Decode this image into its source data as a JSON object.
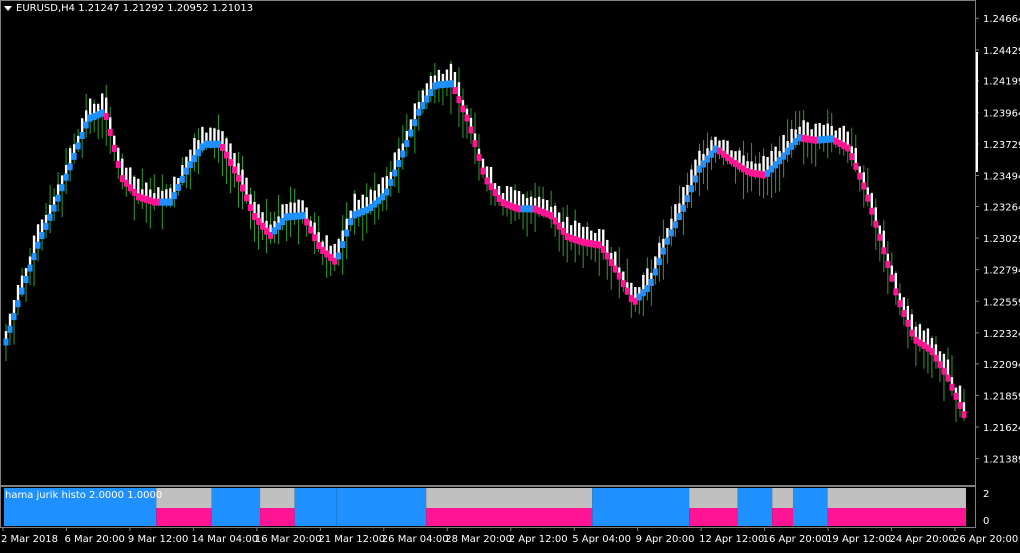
{
  "window": {
    "symbol_header": "EURUSD,H4  1.21247 1.21292 1.20952 1.21013"
  },
  "colors": {
    "background": "#000000",
    "bull": "#1e90ff",
    "bear": "#ff1493",
    "candle": "#ffffff",
    "wick": "#2e9e2e",
    "neutral": "#c0c0c0"
  },
  "subwindow": {
    "label": "hama jurik histo 2.0000 1.0000",
    "ticks": [
      "2",
      "0"
    ]
  },
  "chart_data": {
    "type": "line",
    "title": "EURUSD,H4  1.21247 1.21292 1.20952 1.21013",
    "price_axis": {
      "ylim": [
        1.2123,
        1.2474
      ],
      "ticks": [
        "1.24664",
        "1.24429",
        "1.24199",
        "1.23964",
        "1.23729",
        "1.23494",
        "1.23264",
        "1.23029",
        "1.22794",
        "1.22559",
        "1.22324",
        "1.22094",
        "1.21859",
        "1.21624",
        "1.21389"
      ]
    },
    "time_axis": {
      "labels": [
        "2 Mar 2018",
        "6 Mar 20:00",
        "9 Mar 12:00",
        "14 Mar 04:00",
        "16 Mar 20:00",
        "21 Mar 12:00",
        "26 Mar 04:00",
        "28 Mar 20:00",
        "2 Apr 12:00",
        "5 Apr 04:00",
        "9 Apr 20:00",
        "12 Apr 12:00",
        "16 Apr 20:00",
        "19 Apr 12:00",
        "24 Apr 20:00",
        "26 Apr 20:00"
      ]
    },
    "series": [
      {
        "values": [
          1.2226,
          1.2265,
          1.23,
          1.2328,
          1.236,
          1.2392,
          1.2397,
          1.2348,
          1.2334,
          1.233,
          1.233,
          1.2355,
          1.2373,
          1.2373,
          1.235,
          1.232,
          1.2305,
          1.2319,
          1.232,
          1.2296,
          1.2285,
          1.232,
          1.2325,
          1.2336,
          1.2365,
          1.2397,
          1.2417,
          1.2418,
          1.239,
          1.2348,
          1.233,
          1.2325,
          1.2325,
          1.232,
          1.2304,
          1.23,
          1.2298,
          1.2278,
          1.2255,
          1.2268,
          1.23,
          1.2325,
          1.2355,
          1.237,
          1.236,
          1.2352,
          1.235,
          1.2363,
          1.2378,
          1.2376,
          1.2377,
          1.237,
          1.234,
          1.23,
          1.2258,
          1.2228,
          1.222,
          1.22,
          1.2172
        ]
      }
    ],
    "histogram": {
      "ylim": [
        0,
        2
      ],
      "segments": [
        {
          "state": "bull",
          "bars": 22
        },
        {
          "state": "bear",
          "bars": 8
        },
        {
          "state": "bull",
          "bars": 7
        },
        {
          "state": "bear",
          "bars": 5
        },
        {
          "state": "bull",
          "bars": 6
        },
        {
          "state": "bull",
          "bars": 13
        },
        {
          "state": "bear",
          "bars": 24
        },
        {
          "state": "bull",
          "bars": 14
        },
        {
          "state": "bear",
          "bars": 7
        },
        {
          "state": "bull",
          "bars": 5
        },
        {
          "state": "bear",
          "bars": 3
        },
        {
          "state": "bull",
          "bars": 5
        },
        {
          "state": "bear",
          "bars": 20
        }
      ]
    }
  }
}
